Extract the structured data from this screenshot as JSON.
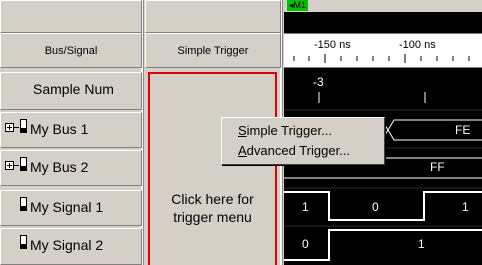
{
  "marker": {
    "label": "M1"
  },
  "columns": {
    "bus_signal": "Bus/Signal",
    "simple_trigger": "Simple Trigger"
  },
  "ruler": {
    "ticks": [
      "-150 ns",
      "-100 ns"
    ]
  },
  "rows": [
    {
      "label": "Sample Num",
      "value": "-3",
      "kind": "sample"
    },
    {
      "label": "My Bus 1",
      "value": "FE",
      "kind": "bus"
    },
    {
      "label": "My Bus 2",
      "value": "FF",
      "kind": "bus"
    },
    {
      "label": "My Signal 1",
      "values": [
        "1",
        "0",
        "1"
      ],
      "kind": "signal"
    },
    {
      "label": "My Signal 2",
      "values": [
        "0",
        "1"
      ],
      "kind": "signal"
    }
  ],
  "trigger_hint": {
    "line1": "Click here for",
    "line2": "trigger menu"
  },
  "context_menu": {
    "items": [
      {
        "accel": "S",
        "rest": "imple Trigger..."
      },
      {
        "accel": "A",
        "rest": "dvanced Trigger..."
      }
    ]
  },
  "colors": {
    "trigger_border": "#e00000",
    "marker_flag": "#00c000",
    "waveform_bg": "#000000"
  }
}
